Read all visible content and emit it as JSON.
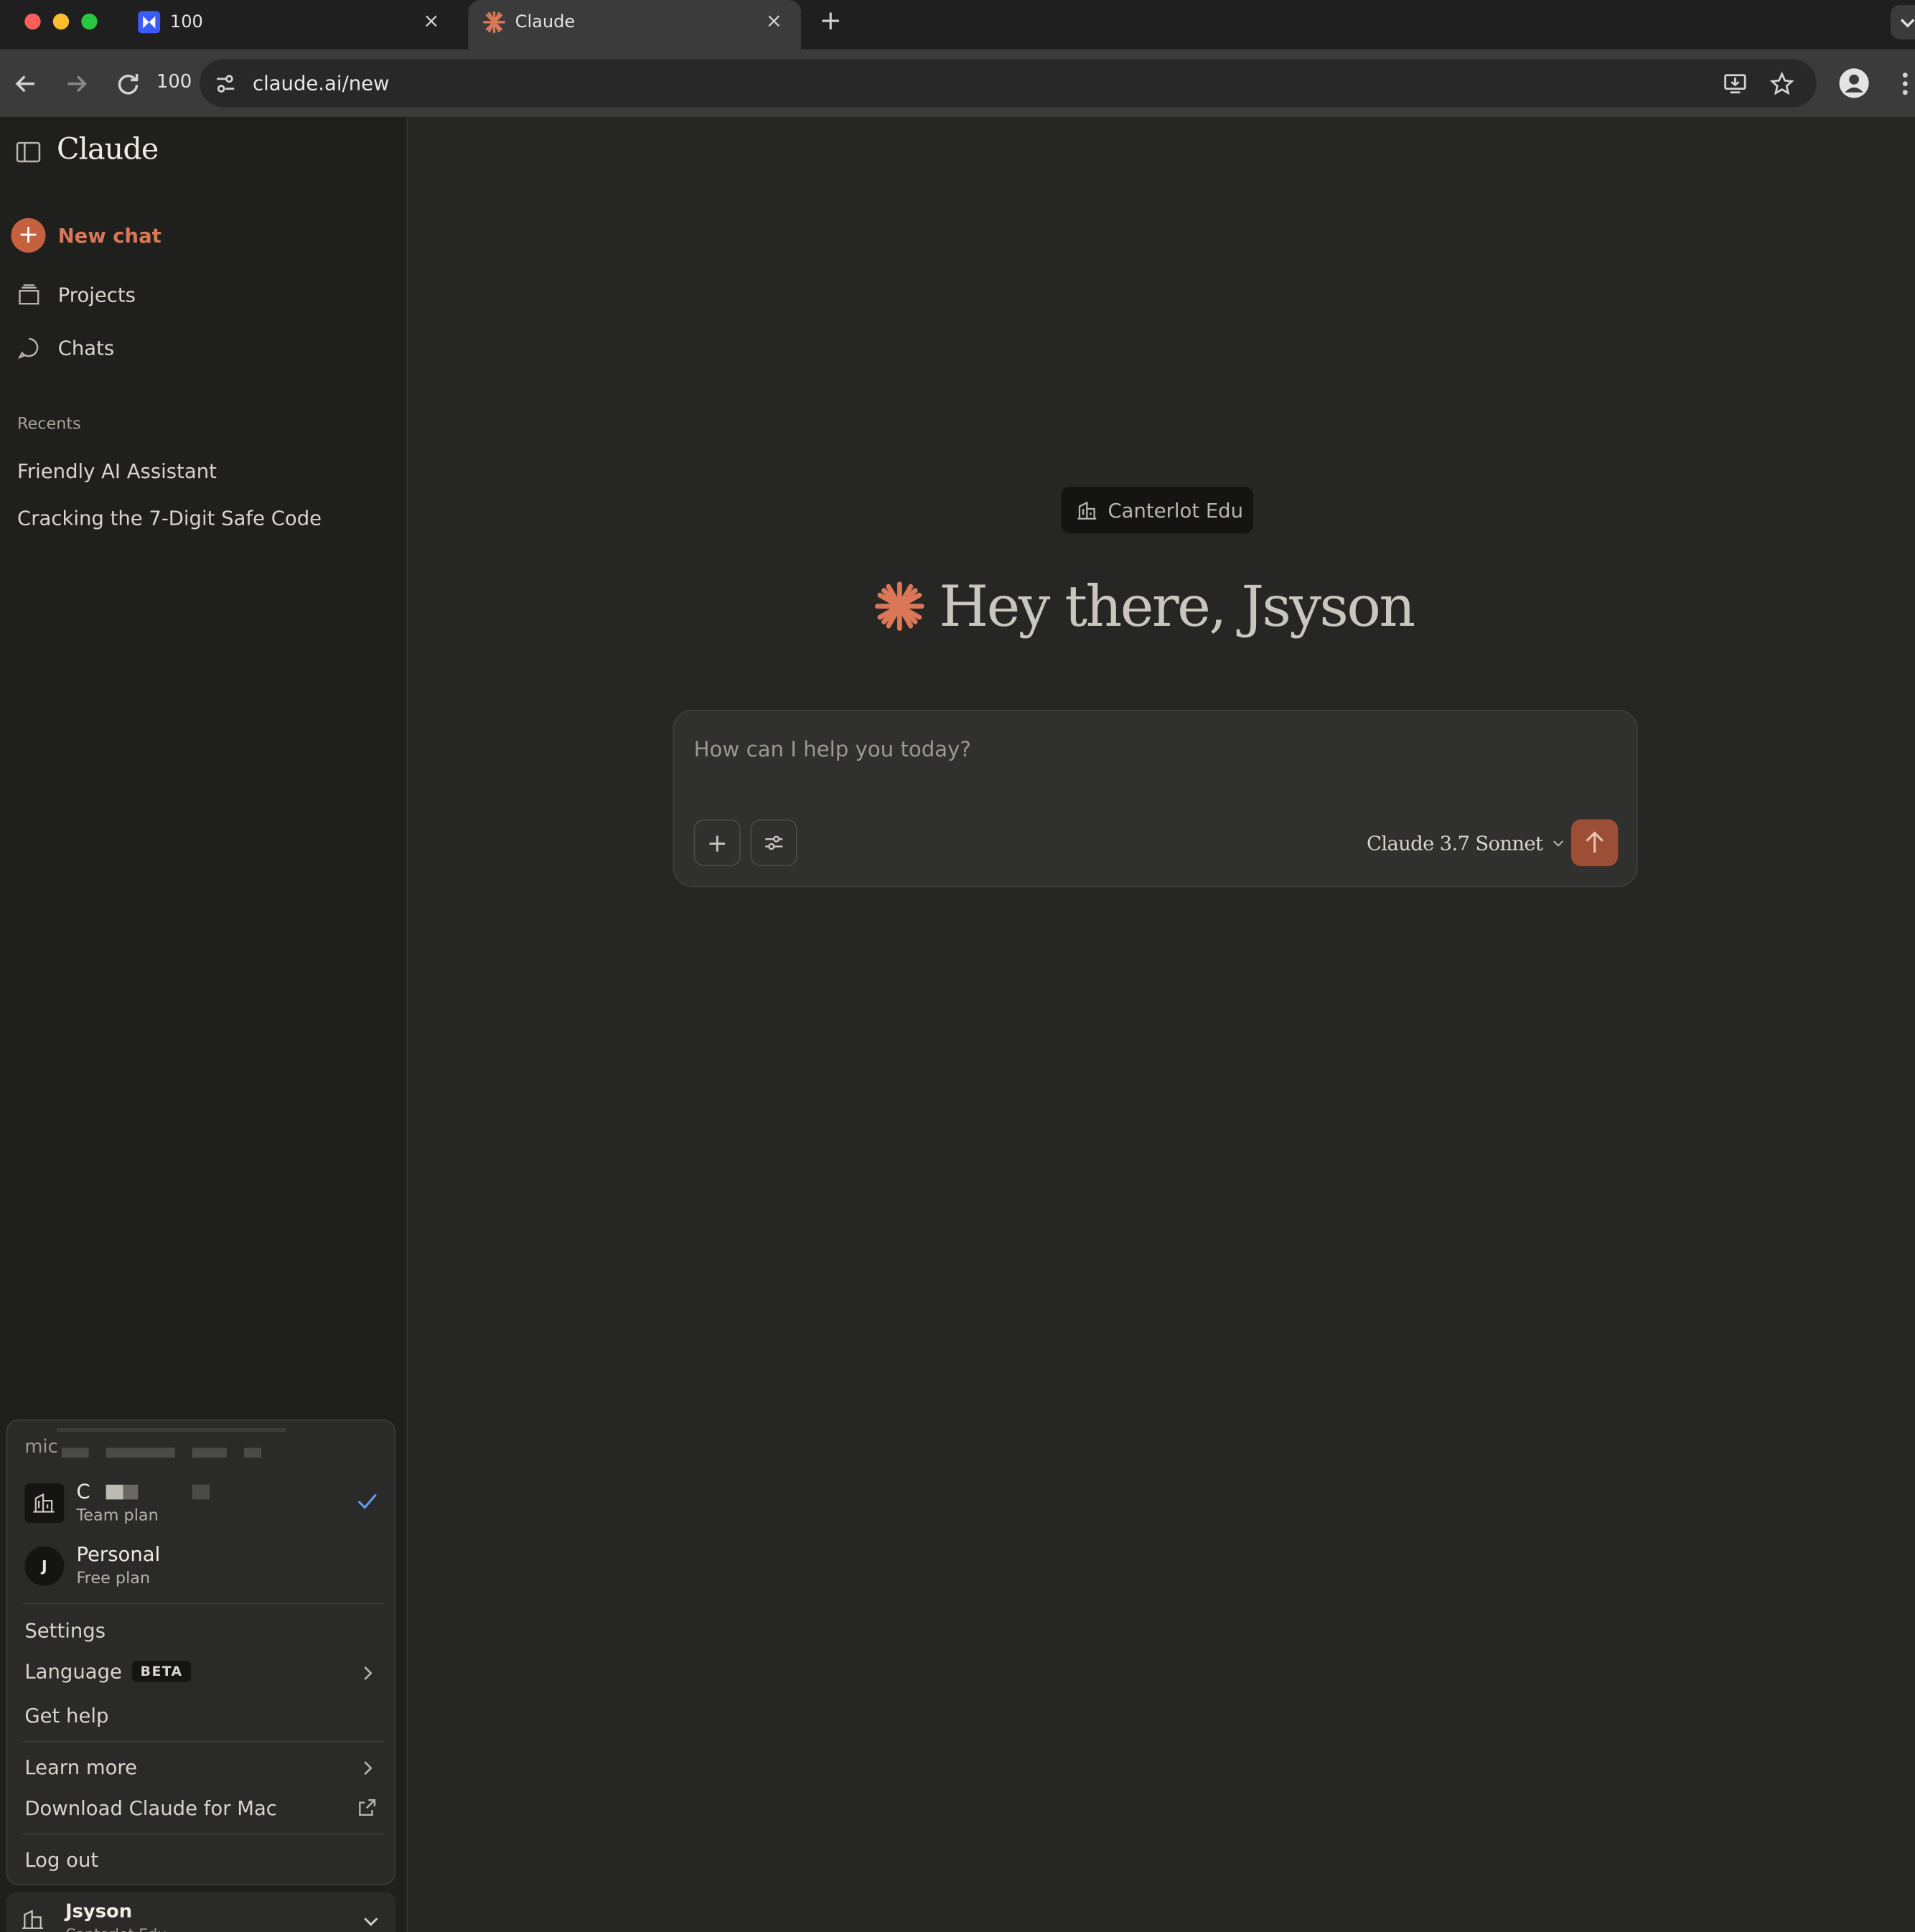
{
  "browser": {
    "tabs": [
      {
        "title": "100",
        "close": "×"
      },
      {
        "title": "Claude",
        "close": "×"
      }
    ],
    "new_tab": "+",
    "zoom": "100",
    "url": "claude.ai/new",
    "colors": {
      "close": "#ff5f57",
      "minimize": "#febc2e",
      "zoom": "#28c840"
    }
  },
  "sidebar": {
    "brand": "Claude",
    "new_chat": "New chat",
    "nav": [
      {
        "label": "Projects",
        "icon": "folder-icon"
      },
      {
        "label": "Chats",
        "icon": "chat-bubble-icon"
      }
    ],
    "recents_heading": "Recents",
    "recents": [
      "Friendly AI Assistant",
      "Cracking the 7-Digit Safe Code"
    ]
  },
  "account_menu": {
    "email": "mic",
    "orgs": [
      {
        "name": "C",
        "plan": "Team plan",
        "selected": true
      },
      {
        "name": "Personal",
        "plan": "Free plan",
        "avatar": "J"
      }
    ],
    "items": {
      "settings": "Settings",
      "language": "Language",
      "language_badge": "BETA",
      "help": "Get help",
      "learn_more": "Learn more",
      "download": "Download Claude for Mac",
      "logout": "Log out"
    },
    "user_name": "Jsyson",
    "user_org": "Canterlot Edu"
  },
  "main": {
    "org_chip": "Canterlot Edu",
    "greeting": "Hey there, Jsyson",
    "composer_placeholder": "How can I help you today?",
    "add_button": "+",
    "model": "Claude 3.7 Sonnet",
    "accent": "#d97757"
  }
}
